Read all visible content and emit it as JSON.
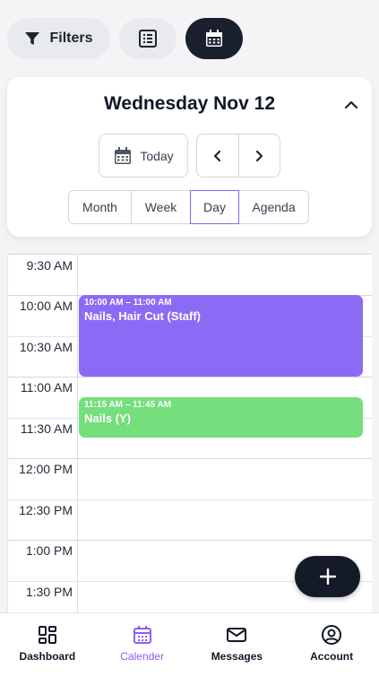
{
  "toolbar": {
    "filters_label": "Filters",
    "filter_icon": "filter-icon",
    "list_icon": "list-view-icon",
    "calendar_icon": "calendar-view-icon",
    "active_view": "calendar"
  },
  "header": {
    "date_title": "Wednesday Nov 12",
    "today_label": "Today",
    "prev_icon": "chevron-left-icon",
    "next_icon": "chevron-right-icon",
    "collapse_icon": "chevron-up-icon",
    "views": [
      {
        "label": "Month",
        "active": false
      },
      {
        "label": "Week",
        "active": false
      },
      {
        "label": "Day",
        "active": true
      },
      {
        "label": "Agenda",
        "active": false
      }
    ]
  },
  "calendar": {
    "time_slots": [
      "9:30 AM",
      "10:00 AM",
      "10:30 AM",
      "11:00 AM",
      "11:30 AM",
      "12:00 PM",
      "12:30 PM",
      "1:00 PM",
      "1:30 PM"
    ],
    "events": [
      {
        "time": "10:00 AM – 11:00 AM",
        "title": "Nails, Hair Cut (Staff)",
        "color": "#8b6bf6"
      },
      {
        "time": "11:15 AM – 11:45 AM",
        "title": "Nails (Y)",
        "color": "#74df7c"
      }
    ]
  },
  "fab": {
    "icon": "plus-icon"
  },
  "bottom_nav": [
    {
      "label": "Dashboard",
      "icon": "dashboard-icon",
      "active": false
    },
    {
      "label": "Calender",
      "icon": "calendar-icon",
      "active": true
    },
    {
      "label": "Messages",
      "icon": "mail-icon",
      "active": false
    },
    {
      "label": "Account",
      "icon": "account-icon",
      "active": false
    }
  ],
  "colors": {
    "accent": "#8b5cf6",
    "dark": "#1a1f2e",
    "event_purple": "#8b6bf6",
    "event_green": "#74df7c"
  }
}
